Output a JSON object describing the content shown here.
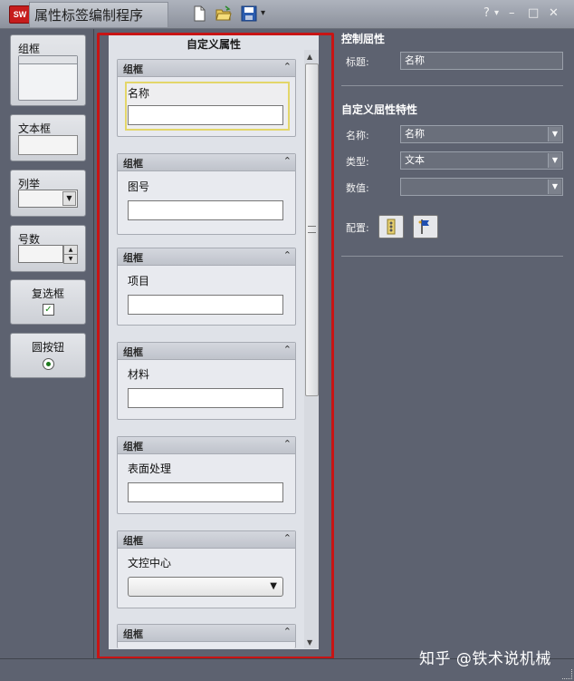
{
  "app": {
    "logo": "SW",
    "title": "属性标签编制程序"
  },
  "toolbar": {
    "icons": [
      "new-file-icon",
      "open-folder-icon",
      "save-icon"
    ]
  },
  "window_controls": {
    "help": "?",
    "help_dropdown": "▾",
    "minimize": "–",
    "maximize": "□",
    "close": "✕"
  },
  "palette": {
    "items": [
      {
        "label": "组框"
      },
      {
        "label": "文本框"
      },
      {
        "label": "列举"
      },
      {
        "label": "号数"
      },
      {
        "label": "复选框"
      },
      {
        "label": "圆按钮"
      }
    ]
  },
  "center": {
    "title": "自定义属性",
    "groups": [
      {
        "header": "组框",
        "field_label": "名称",
        "field_type": "text"
      },
      {
        "header": "组框",
        "field_label": "图号",
        "field_type": "text"
      },
      {
        "header": "组框",
        "field_label": "项目",
        "field_type": "text"
      },
      {
        "header": "组框",
        "field_label": "材料",
        "field_type": "text"
      },
      {
        "header": "组框",
        "field_label": "表面处理",
        "field_type": "text"
      },
      {
        "header": "组框",
        "field_label": "文控中心",
        "field_type": "dropdown"
      },
      {
        "header": "组框"
      }
    ]
  },
  "props": {
    "control_section": {
      "title": "控制屈性",
      "caption_label": "标题:",
      "caption_value": "名称"
    },
    "custom_section": {
      "title": "自定义屈性特性",
      "name_label": "名称:",
      "name_value": "名称",
      "type_label": "类型:",
      "type_value": "文本",
      "value_label": "数值:",
      "value_value": "",
      "config_label": "配置:"
    }
  },
  "watermark": "知乎 @铁术说机械",
  "colors": {
    "highlight_border": "#c81414",
    "background": "#5d6270",
    "selected_field_border": "#e3d66a"
  }
}
